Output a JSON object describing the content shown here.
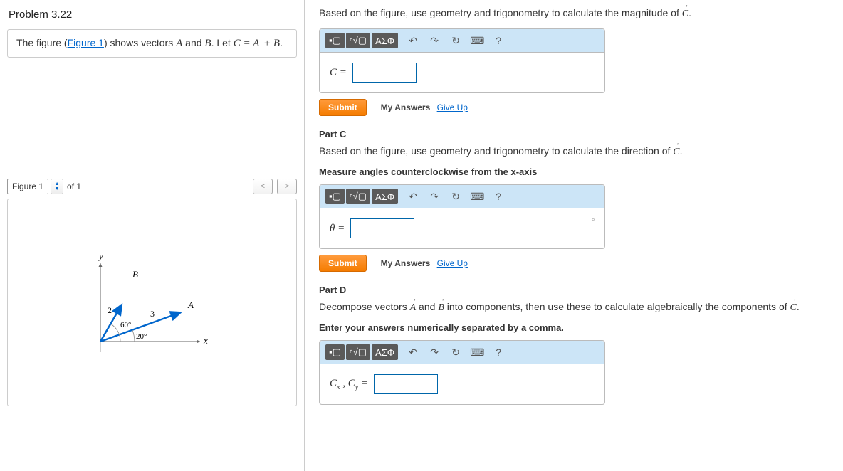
{
  "header": {
    "title": "Problem 3.22"
  },
  "intro": {
    "prefix": "The figure (",
    "figure_link": "Figure 1",
    "middle": ") shows vectors ",
    "vectorA": "A",
    "and_text": " and ",
    "vectorB": "B",
    "let_text": ". Let ",
    "vectorC": "C",
    "equals": " = ",
    "sum": "A + B",
    "period": "."
  },
  "figure_nav": {
    "label": "Figure 1",
    "of_text": "of 1"
  },
  "figure": {
    "y_label": "y",
    "x_label": "x",
    "B_label": "B",
    "A_label": "A",
    "B_len": "2",
    "A_len": "3",
    "B_ang": "60°",
    "A_ang": "20°"
  },
  "partB": {
    "instr_prefix": "Based on the figure, use geometry and trigonometry to calculate the magnitude of ",
    "vectorC": "C",
    "period": ".",
    "var_label": "C =",
    "submit": "Submit",
    "my_answers": "My Answers",
    "give_up": "Give Up"
  },
  "partC": {
    "title": "Part C",
    "instr_prefix": "Based on the figure, use geometry and trigonometry to calculate the direction of ",
    "vectorC": "C",
    "period": ".",
    "bold_instr": "Measure angles counterclockwise from the x-axis",
    "var_label": "θ =",
    "unit": "°",
    "submit": "Submit",
    "my_answers": "My Answers",
    "give_up": "Give Up"
  },
  "partD": {
    "title": "Part D",
    "instr_prefix": "Decompose vectors ",
    "vectorA": "A",
    "and_text": " and ",
    "vectorB": "B",
    "mid_text": " into components, then use these to calculate algebraically the components of ",
    "vectorC": "C",
    "period": ".",
    "bold_instr": "Enter your answers numerically separated by a comma.",
    "var_label_html": "Cₓ , C_y ="
  },
  "toolbar": {
    "sqrt": "ⁿ√▢",
    "greek": "ΑΣΦ",
    "undo": "↶",
    "redo": "↷",
    "reset": "↻",
    "keyboard": "⌨",
    "help": "?"
  }
}
